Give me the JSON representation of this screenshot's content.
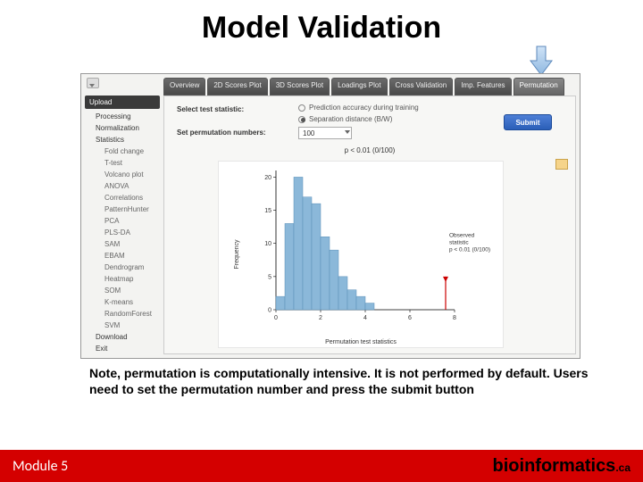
{
  "title": "Model Validation",
  "sidebar": {
    "top_group": "Upload",
    "groups": [
      "Processing",
      "Normalization",
      "Statistics"
    ],
    "stat_items": [
      "Fold change",
      "T-test",
      "Volcano plot",
      "ANOVA",
      "Correlations",
      "PatternHunter",
      "PCA",
      "PLS-DA",
      "SAM",
      "EBAM",
      "Dendrogram",
      "Heatmap",
      "SOM",
      "K-means",
      "RandomForest",
      "SVM"
    ],
    "bottom_items": [
      "Download",
      "Exit"
    ]
  },
  "tabs": [
    "Overview",
    "2D Scores Plot",
    "3D Scores Plot",
    "Loadings Plot",
    "Cross Validation",
    "Imp. Features",
    "Permutation"
  ],
  "active_tab_index": 6,
  "form": {
    "stat_label": "Select test statistic:",
    "radio1": "Prediction accuracy during training",
    "radio2": "Separation distance (B/W)",
    "perm_label": "Set permutation numbers:",
    "perm_value": "100",
    "submit": "Submit"
  },
  "pvalue_text": "p < 0.01 (0/100)",
  "annotation": {
    "l1": "Observed",
    "l2": "statistic",
    "l3": "p < 0.01 (0/100)"
  },
  "chart_data": {
    "type": "bar",
    "title": "",
    "xlabel": "Permutation test statistics",
    "ylabel": "Frequency",
    "xlim": [
      0,
      8
    ],
    "ylim": [
      0,
      21
    ],
    "x_ticks": [
      0,
      2,
      4,
      6,
      8
    ],
    "y_ticks": [
      0,
      5,
      10,
      15,
      20
    ],
    "bin_edges": [
      0.0,
      0.4,
      0.8,
      1.2,
      1.6,
      2.0,
      2.4,
      2.8,
      3.2,
      3.6,
      4.0,
      4.4
    ],
    "counts": [
      2,
      13,
      20,
      17,
      16,
      11,
      9,
      5,
      3,
      2,
      1
    ],
    "observed_x": 7.6
  },
  "note": "Note, permutation is computationally intensive. It is not performed by default. Users need to set the permutation number and press the submit button",
  "footer": {
    "module": "Module 5",
    "brand": "bioinformatics",
    "tld": ".ca"
  }
}
